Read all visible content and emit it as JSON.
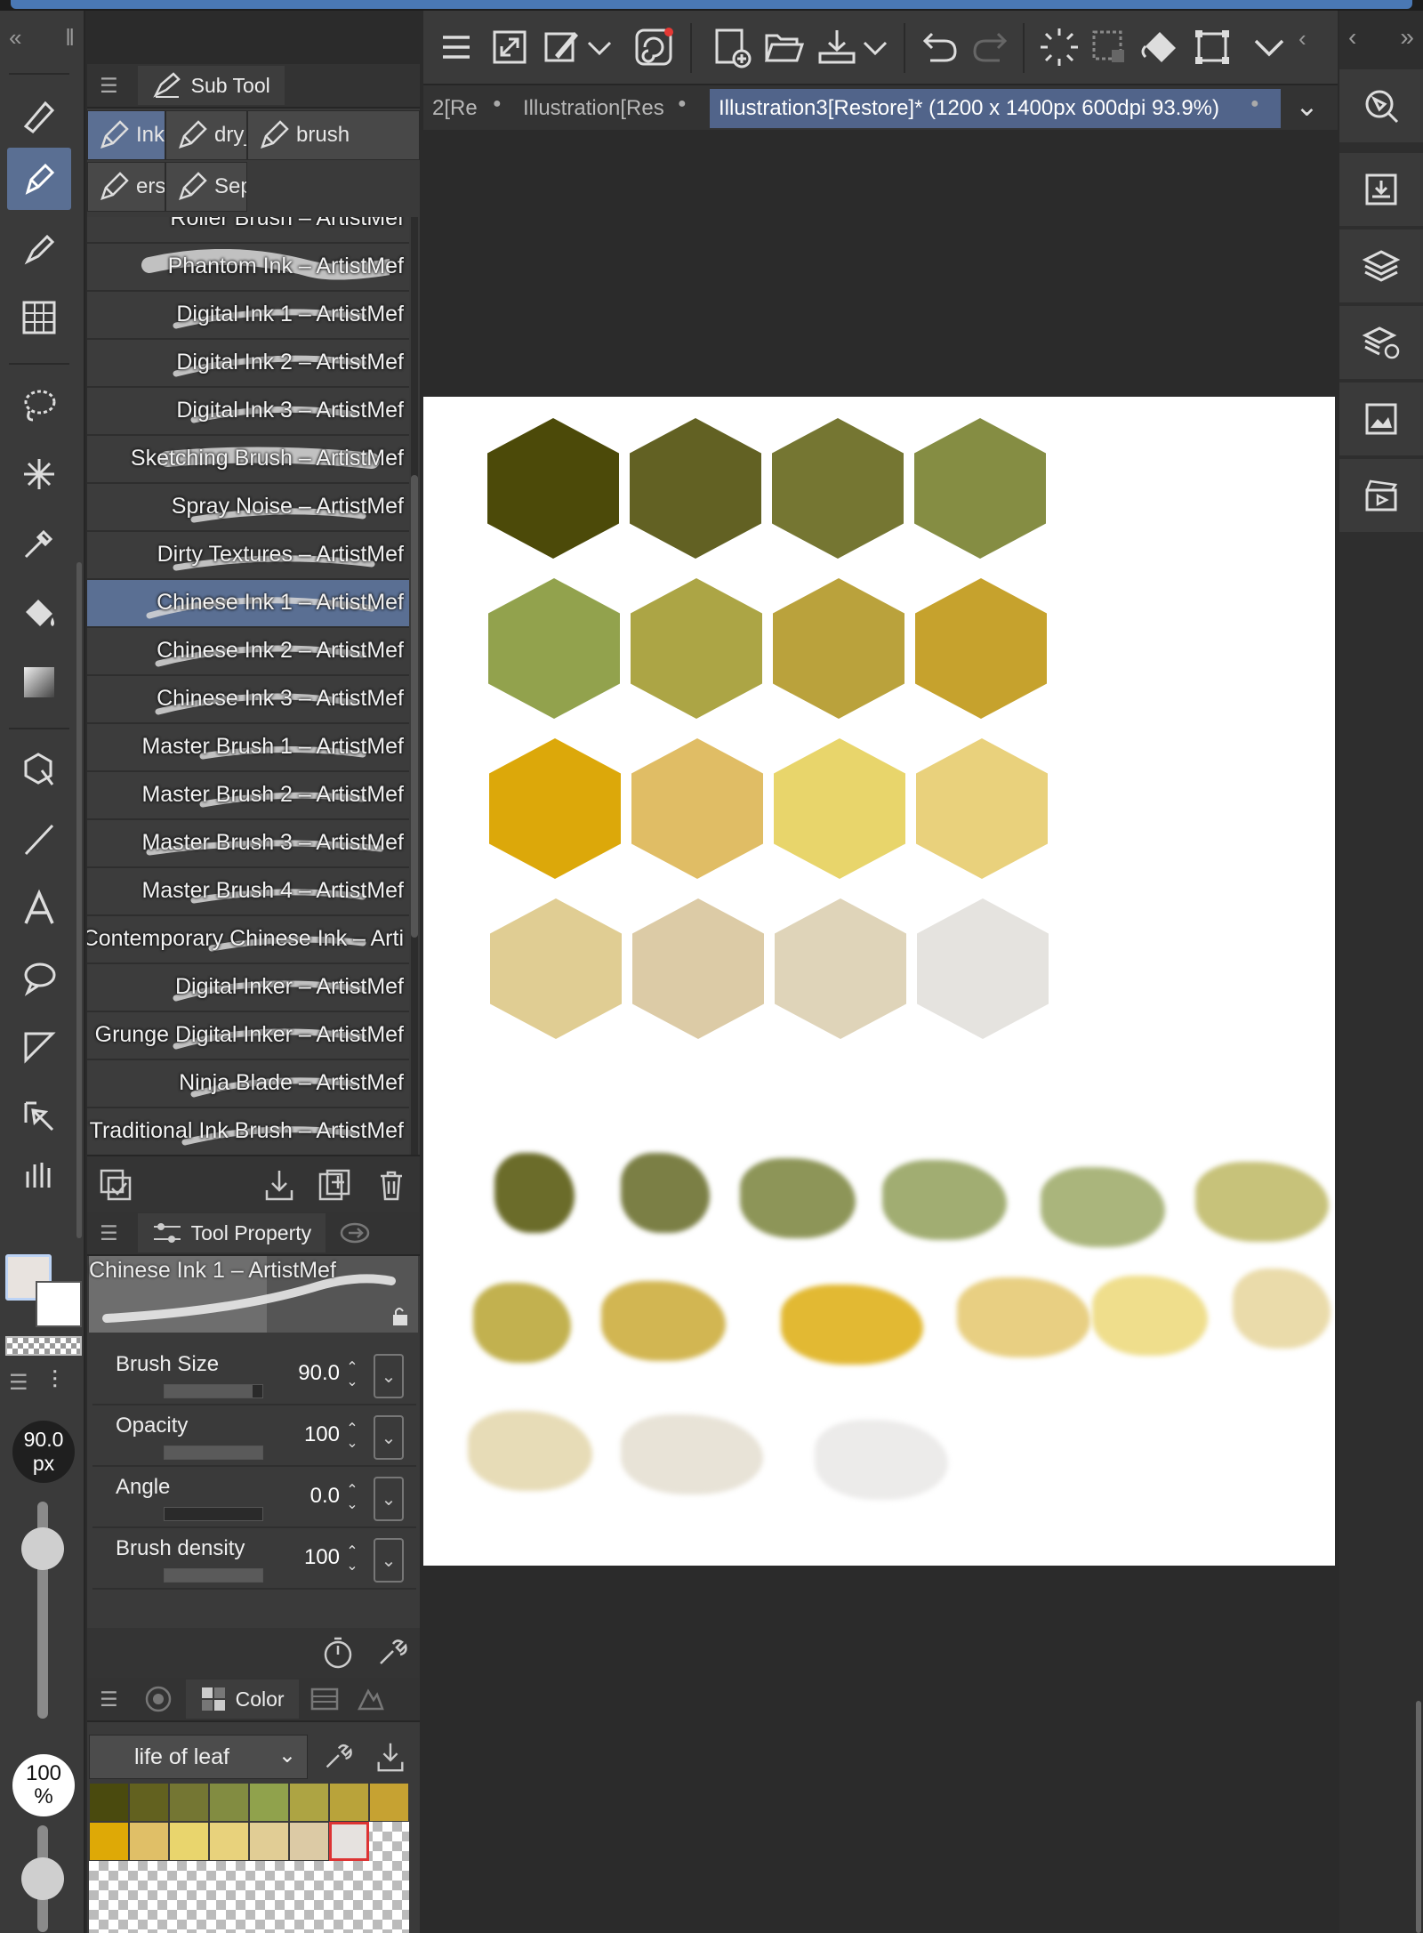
{
  "colors": {
    "accent": "#5a6f93",
    "panel": "#3a3a3a",
    "canvas_bg": "#2b2b2b",
    "paper": "#ffffff",
    "topbar": "#4a78b4"
  },
  "subtool": {
    "title": "Sub Tool",
    "groups": [
      {
        "label": "Inktol",
        "selected": true
      },
      {
        "label": "dry_o",
        "selected": false
      },
      {
        "label": "brush",
        "selected": false
      },
      {
        "label": "erskin",
        "selected": false
      },
      {
        "label": "Sephi",
        "selected": false
      }
    ],
    "brushes": [
      {
        "name": "Roller Brush – ArtistMef",
        "selected": false
      },
      {
        "name": "Phantom Ink – ArtistMef",
        "selected": false
      },
      {
        "name": "Digital Ink 1 – ArtistMef",
        "selected": false
      },
      {
        "name": "Digital Ink 2 – ArtistMef",
        "selected": false
      },
      {
        "name": "Digital Ink 3 – ArtistMef",
        "selected": false
      },
      {
        "name": "Sketching Brush – ArtistMef",
        "selected": false
      },
      {
        "name": "Spray Noise – ArtistMef",
        "selected": false
      },
      {
        "name": "Dirty Textures – ArtistMef",
        "selected": false
      },
      {
        "name": "Chinese Ink 1 – ArtistMef",
        "selected": true
      },
      {
        "name": "Chinese Ink 2 – ArtistMef",
        "selected": false
      },
      {
        "name": "Chinese Ink 3 – ArtistMef",
        "selected": false
      },
      {
        "name": "Master Brush 1 – ArtistMef",
        "selected": false
      },
      {
        "name": "Master Brush 2 – ArtistMef",
        "selected": false
      },
      {
        "name": "Master Brush 3 – ArtistMef",
        "selected": false
      },
      {
        "name": "Master Brush 4 – ArtistMef",
        "selected": false
      },
      {
        "name": "Contemporary Chinese Ink – Arti",
        "selected": false
      },
      {
        "name": "Digital Inker – ArtistMef",
        "selected": false
      },
      {
        "name": "Grunge Digital Inker – ArtistMef",
        "selected": false
      },
      {
        "name": "Ninja Blade – ArtistMef",
        "selected": false
      },
      {
        "name": "Traditional Ink Brush – ArtistMef",
        "selected": false
      }
    ]
  },
  "toolprop": {
    "title": "Tool Property",
    "brush_name": "Chinese Ink 1 – ArtistMef",
    "props": [
      {
        "label": "Brush Size",
        "value": "90.0",
        "fill": 0.9
      },
      {
        "label": "Opacity",
        "value": "100",
        "fill": 1.0
      },
      {
        "label": "Angle",
        "value": "0.0",
        "fill": 0.0
      },
      {
        "label": "Brush density",
        "value": "100",
        "fill": 1.0
      }
    ]
  },
  "color_panel": {
    "title": "Color",
    "palette_name": "life of leaf",
    "swatches_row1": [
      "#4a4a0e",
      "#62611f",
      "#747633",
      "#828c41",
      "#90a24c",
      "#ada443",
      "#b9a33a",
      "#c6a232"
    ],
    "swatches_row2": [
      "#dea906",
      "#e0bf67",
      "#e9d56d",
      "#e8d27c",
      "#e1cd95",
      "#dccaa5",
      "#e6e2df"
    ]
  },
  "left_toolbar": {
    "size_value": "90.0",
    "size_unit": "px",
    "opacity_value": "100",
    "opacity_unit": "%",
    "size_level": 0.85,
    "opacity_level": 0.5
  },
  "document_tabs": [
    {
      "label": "2[Re",
      "active": false
    },
    {
      "label": "Illustration[Res",
      "active": false
    },
    {
      "label": "Illustration3[Restore]* (1200 x 1400px 600dpi 93.9%)",
      "active": true
    }
  ],
  "canvas": {
    "hex_rows": [
      [
        "#4c4a09",
        "#626123",
        "#757632",
        "#858d43"
      ],
      [
        "#92a24d",
        "#aca545",
        "#baa23c",
        "#c6a22d"
      ],
      [
        "#dca80a",
        "#e0bd65",
        "#e8d56b",
        "#e9d17c"
      ],
      [
        "#e0cd93",
        "#dccba6",
        "#dfd4b9",
        "#e5e3df"
      ]
    ],
    "dabs": [
      {
        "color": "#6b6c2a"
      },
      {
        "color": "#7b7f45"
      },
      {
        "color": "#8d9558"
      },
      {
        "color": "#a1ad72"
      },
      {
        "color": "#aab57c"
      },
      {
        "color": "#c7c27a"
      },
      {
        "color": "#c2b14f"
      },
      {
        "color": "#d2b652"
      },
      {
        "color": "#e2b933"
      },
      {
        "color": "#e8cf82"
      },
      {
        "color": "#efde8c"
      },
      {
        "color": "#eadbaa"
      },
      {
        "color": "#e7dcb7"
      },
      {
        "color": "#e8e3d7"
      },
      {
        "color": "#ecebea"
      }
    ]
  }
}
